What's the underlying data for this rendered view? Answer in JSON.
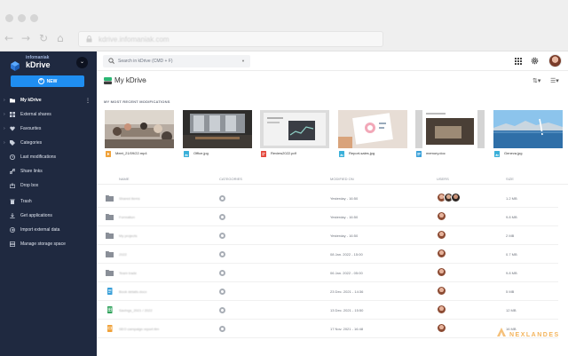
{
  "browser": {
    "url": "kdrive.infomaniak.com"
  },
  "sidebar": {
    "brand_small": "infomaniak",
    "brand": "kDrive",
    "new_label": "NEW",
    "items": [
      {
        "label": "My kDrive",
        "icon": "folder-icon"
      },
      {
        "label": "External shares",
        "icon": "share-icon"
      },
      {
        "label": "Favourites",
        "icon": "heart-icon"
      },
      {
        "label": "Categories",
        "icon": "tag-icon"
      },
      {
        "label": "Last modifications",
        "icon": "clock-icon"
      },
      {
        "label": "Share links",
        "icon": "link-icon"
      },
      {
        "label": "Drop box",
        "icon": "dropbox-icon"
      },
      {
        "label": "Trash",
        "icon": "trash-icon"
      },
      {
        "label": "Get applications",
        "icon": "download-icon"
      },
      {
        "label": "Import external data",
        "icon": "import-icon"
      },
      {
        "label": "Manage storage space",
        "icon": "storage-icon"
      }
    ]
  },
  "topbar": {
    "search_placeholder": "Search in kDrive (CMD + F)"
  },
  "main": {
    "title": "My kDrive",
    "recent_title": "MY MOST RECENT MODIFICATIONS",
    "recent": [
      {
        "name": "Meet_21/09/22.mp4",
        "type": "video"
      },
      {
        "name": "Office.jpg",
        "type": "image"
      },
      {
        "name": "Review2022.pdf",
        "type": "pdf"
      },
      {
        "name": "Report-sales.jpg",
        "type": "image"
      },
      {
        "name": "memory.doc",
        "type": "doc"
      },
      {
        "name": "Geneva.jpg",
        "type": "image"
      }
    ],
    "columns": {
      "name": "NAME",
      "categories": "CATEGORIES",
      "modified": "MODIFIED ON",
      "users": "USERS",
      "size": "SIZE"
    },
    "rows": [
      {
        "name": "Shared items",
        "kind": "folder",
        "modified": "Yesterday - 16:50",
        "size": "1.2 MB",
        "users": 3
      },
      {
        "name": "Formation",
        "kind": "folder",
        "modified": "Yesterday - 16:50",
        "size": "9.8 MB",
        "users": 1
      },
      {
        "name": "My projects",
        "kind": "folder",
        "modified": "Yesterday - 16:50",
        "size": "2 MB",
        "users": 1
      },
      {
        "name": "2022",
        "kind": "folder",
        "modified": "08 Jan. 2022 - 15:00",
        "size": "0.7 MB",
        "users": 1
      },
      {
        "name": "Team trade",
        "kind": "folder",
        "modified": "06 Jan. 2022 - 05:00",
        "size": "9.8 MB",
        "users": 1
      },
      {
        "name": "Book details.docx",
        "kind": "doc",
        "modified": "23 Dec. 2021 - 14:36",
        "size": "5 MB",
        "users": 1
      },
      {
        "name": "Savings_2021 / 2022",
        "kind": "sheet",
        "modified": "13 Dec. 2021 - 15:50",
        "size": "12 MB",
        "users": 1
      },
      {
        "name": "SEO campaign report.ttm",
        "kind": "slides",
        "modified": "17 Nov. 2021 - 16:48",
        "size": "16 MB",
        "users": 1
      }
    ]
  },
  "watermark": "NEXLANDES"
}
